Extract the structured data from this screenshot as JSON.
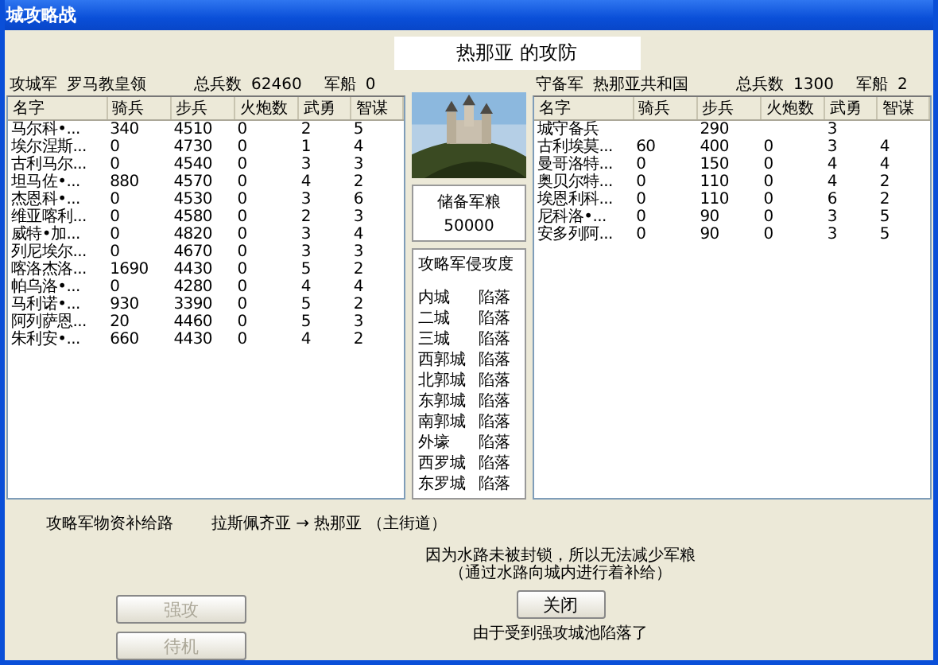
{
  "window": {
    "title": "城攻略战"
  },
  "battle_title": "热那亚 的攻防",
  "attacker": {
    "label": "攻城军",
    "faction": "罗马教皇领",
    "troops_label": "总兵数",
    "troops": "62460",
    "ships_label": "军船",
    "ships": "0"
  },
  "defender": {
    "label": "守备军",
    "faction": "热那亚共和国",
    "troops_label": "总兵数",
    "troops": "1300",
    "ships_label": "军船",
    "ships": "2"
  },
  "attacker_columns": [
    "名字",
    "骑兵",
    "步兵",
    "火炮数",
    "武勇",
    "智谋"
  ],
  "defender_columns": [
    "名字",
    "骑兵",
    "步兵",
    "火炮数",
    "武勇",
    "智谋"
  ],
  "attacker_rows": [
    [
      "马尔科•...",
      "340",
      "4510",
      "0",
      "2",
      "5"
    ],
    [
      "埃尔涅斯...",
      "0",
      "4730",
      "0",
      "1",
      "4"
    ],
    [
      "古利马尔...",
      "0",
      "4540",
      "0",
      "3",
      "3"
    ],
    [
      "坦马佐•...",
      "880",
      "4570",
      "0",
      "4",
      "2"
    ],
    [
      "杰恩科•...",
      "0",
      "4530",
      "0",
      "3",
      "6"
    ],
    [
      "维亚喀利...",
      "0",
      "4580",
      "0",
      "2",
      "3"
    ],
    [
      "威特•加...",
      "0",
      "4820",
      "0",
      "3",
      "4"
    ],
    [
      "列尼埃尔...",
      "0",
      "4670",
      "0",
      "3",
      "3"
    ],
    [
      "喀洛杰洛...",
      "1690",
      "4430",
      "0",
      "5",
      "2"
    ],
    [
      "帕乌洛•...",
      "0",
      "4280",
      "0",
      "4",
      "4"
    ],
    [
      "马利诺•...",
      "930",
      "3390",
      "0",
      "5",
      "2"
    ],
    [
      "阿列萨恩...",
      "20",
      "4460",
      "0",
      "5",
      "3"
    ],
    [
      "朱利安•...",
      "660",
      "4430",
      "0",
      "4",
      "2"
    ]
  ],
  "defender_rows": [
    [
      "城守备兵",
      null,
      "290",
      null,
      "3",
      null
    ],
    [
      "古利埃莫...",
      "60",
      "400",
      "0",
      "3",
      "4"
    ],
    [
      "曼哥洛特...",
      "0",
      "150",
      "0",
      "4",
      "4"
    ],
    [
      "奥贝尔特...",
      "0",
      "110",
      "0",
      "4",
      "2"
    ],
    [
      "埃恩利科...",
      "0",
      "110",
      "0",
      "6",
      "2"
    ],
    [
      "尼科洛•...",
      "0",
      "90",
      "0",
      "3",
      "5"
    ],
    [
      "安多列阿...",
      "0",
      "90",
      "0",
      "3",
      "5"
    ]
  ],
  "picture": {
    "kind": "picture"
  },
  "reserve_food": {
    "label": "储备军粮",
    "value": "50000"
  },
  "invasion": {
    "title": "攻略军侵攻度",
    "items": [
      {
        "area": "内城",
        "status": "陷落"
      },
      {
        "area": "二城",
        "status": "陷落"
      },
      {
        "area": "三城",
        "status": "陷落"
      },
      {
        "area": "西郭城",
        "status": "陷落"
      },
      {
        "area": "北郭城",
        "status": "陷落"
      },
      {
        "area": "东郭城",
        "status": "陷落"
      },
      {
        "area": "南郭城",
        "status": "陷落"
      },
      {
        "area": "外壕",
        "status": "陷落"
      },
      {
        "area": "西罗城",
        "status": "陷落"
      },
      {
        "area": "东罗城",
        "status": "陷落"
      }
    ]
  },
  "supply": {
    "label": "攻略军物资补给路",
    "route": "拉斯佩齐亚 → 热那亚 （主街道）"
  },
  "message": [
    "因为水路未被封锁，所以无法减少军粮",
    "（通过水路向城内进行着补给）"
  ],
  "buttons": [
    {
      "label": "强攻",
      "disabled": true
    },
    {
      "label": "待机",
      "disabled": true
    }
  ],
  "close_button": {
    "label": "关闭",
    "disabled": false
  },
  "footer": "由于受到强攻城池陷落了"
}
